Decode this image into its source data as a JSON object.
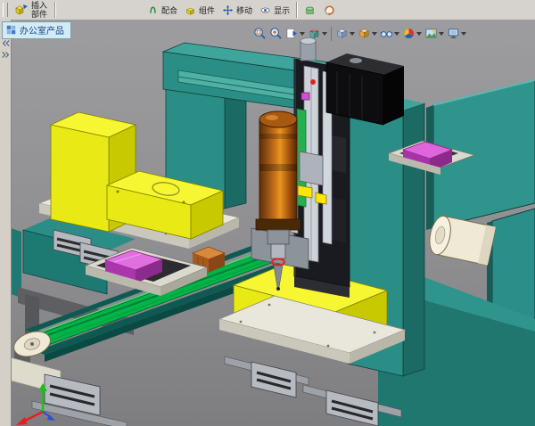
{
  "toolbar_top": {
    "insert_component_button": {
      "line1": "插入",
      "line2": "部件"
    },
    "buttons": [
      {
        "label": "配合",
        "icon": "mate-icon"
      },
      {
        "label": "组件",
        "icon": "component-icon"
      },
      {
        "label": "移动",
        "icon": "move-component-icon"
      },
      {
        "label": "显示",
        "icon": "show-hide-icon"
      }
    ],
    "icon_buttons": [
      {
        "icon": "assembly-features-icon"
      },
      {
        "icon": "motion-study-icon"
      }
    ]
  },
  "document_tab": {
    "label": "办公室产品"
  },
  "left_panel": {
    "icons": [
      "collapse-arrows-icon",
      "panel-handle-icon"
    ]
  },
  "heads_up_toolbar": {
    "items": [
      {
        "icon": "zoom-to-fit"
      },
      {
        "icon": "zoom-to-area"
      },
      {
        "icon": "previous-view"
      },
      {
        "icon": "section-view"
      },
      {
        "icon": "view-orientation"
      },
      {
        "icon": "display-style"
      },
      {
        "icon": "hide-show-items"
      },
      {
        "icon": "edit-appearance"
      },
      {
        "icon": "apply-scene"
      },
      {
        "icon": "view-settings"
      }
    ]
  },
  "viewport": {
    "background_top": "#9d9da0",
    "background_bottom": "#7e7e81"
  },
  "model_colors": {
    "frame_teal": "#2b8e86",
    "fixture_yellow": "#e9e915",
    "belt_green": "#00b546",
    "dispenser_orange": "#c4731a",
    "part_magenta": "#c94fc9",
    "plate_gray": "#e9e7db",
    "actuator_black": "#1a1b20",
    "motor_black": "#0d0d0f",
    "roller_cream": "#efe9d6"
  },
  "triad": {
    "x_axis_color": "#e51f1f",
    "y_axis_color": "#1fbf1f",
    "z_axis_color": "#2b50d6"
  }
}
